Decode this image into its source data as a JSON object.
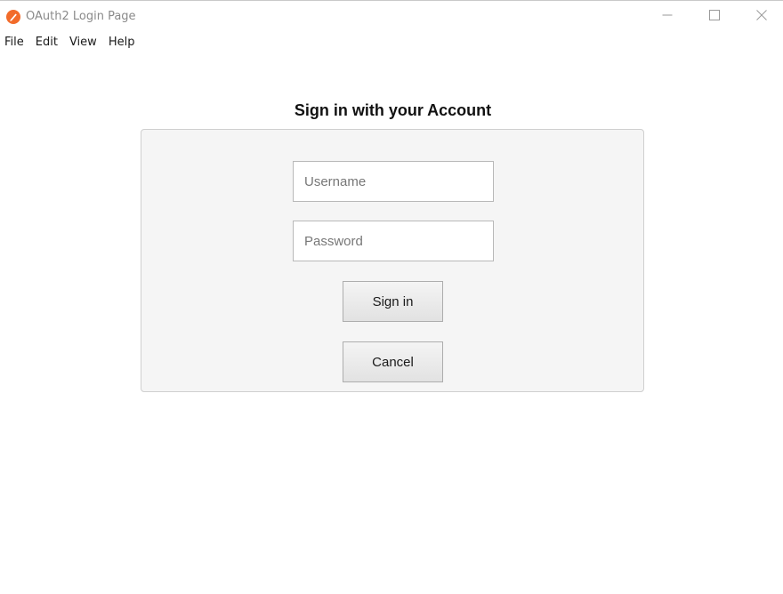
{
  "window": {
    "title": "OAuth2 Login Page",
    "icon": "app-logo-icon",
    "controls": {
      "minimize": "minimize-icon",
      "maximize": "maximize-icon",
      "close": "close-icon"
    }
  },
  "menu": {
    "items": [
      "File",
      "Edit",
      "View",
      "Help"
    ]
  },
  "login": {
    "heading": "Sign in with your Account",
    "username_placeholder": "Username",
    "username_value": "",
    "password_placeholder": "Password",
    "password_value": "",
    "signin_label": "Sign in",
    "cancel_label": "Cancel"
  },
  "colors": {
    "app_icon": "#f26b2a",
    "panel_background": "#f5f5f5",
    "panel_border": "#cfcfcf"
  }
}
